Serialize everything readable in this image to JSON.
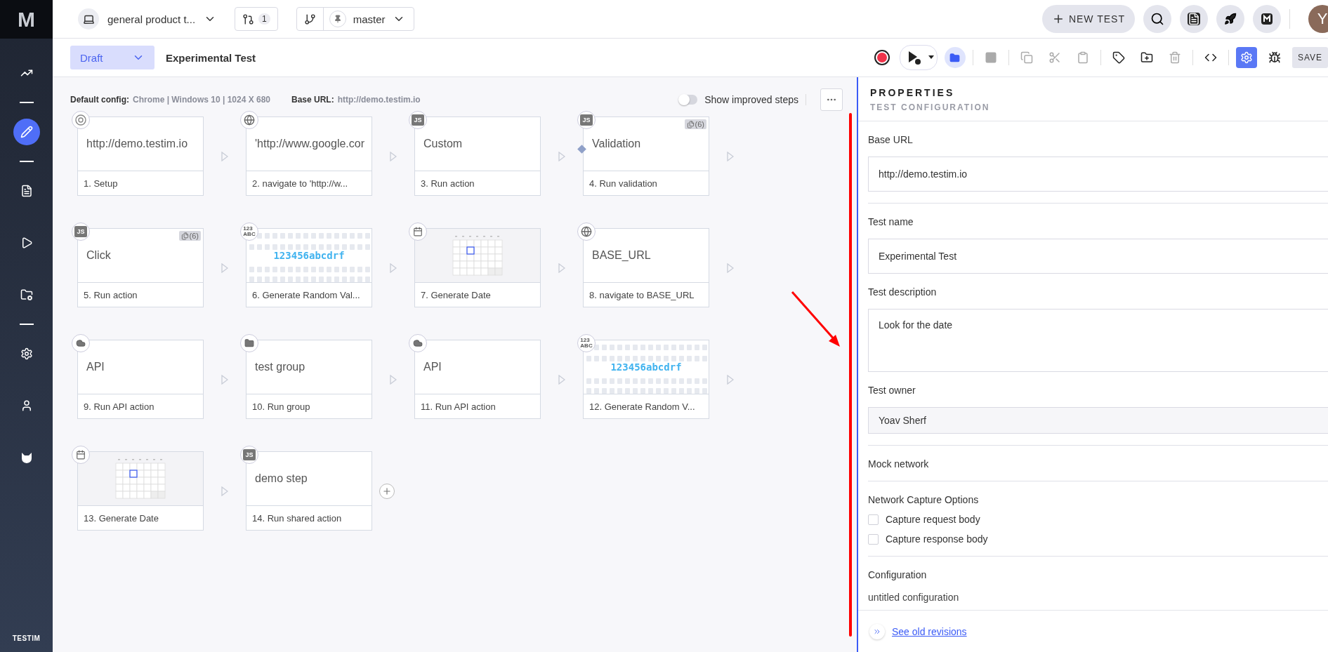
{
  "sidebar": {
    "logo": "M",
    "brand": "TESTIM",
    "items": [
      {
        "kind": "chart",
        "selected": false
      },
      {
        "kind": "divider"
      },
      {
        "kind": "pencil",
        "selected": true
      },
      {
        "kind": "divider"
      },
      {
        "kind": "list",
        "selected": false
      },
      {
        "kind": "play",
        "selected": false
      },
      {
        "kind": "folder-gear",
        "selected": false
      },
      {
        "kind": "divider"
      },
      {
        "kind": "gear",
        "selected": false
      },
      {
        "kind": "user",
        "selected": false
      },
      {
        "kind": "mask",
        "selected": false
      }
    ]
  },
  "topbar": {
    "project": "general product t...",
    "pull_requests": "1",
    "branch": "master",
    "new_test": "NEW TEST",
    "avatar": "Y"
  },
  "toolbar": {
    "status": "Draft",
    "title": "Experimental Test",
    "save": "SAVE",
    "tools": [
      {
        "kind": "record",
        "disabled": false,
        "active": false
      },
      {
        "kind": "run",
        "disabled": false,
        "active": false
      },
      {
        "kind": "folder",
        "disabled": false,
        "active": true
      },
      {
        "kind": "sep"
      },
      {
        "kind": "stop",
        "disabled": true,
        "active": false
      },
      {
        "kind": "sep"
      },
      {
        "kind": "copy",
        "disabled": true,
        "active": false
      },
      {
        "kind": "cut",
        "disabled": true,
        "active": false
      },
      {
        "kind": "paste",
        "disabled": true,
        "active": false
      },
      {
        "kind": "sep"
      },
      {
        "kind": "tag",
        "disabled": false,
        "active": false
      },
      {
        "kind": "folder-plus",
        "disabled": false,
        "active": false
      },
      {
        "kind": "trash",
        "disabled": true,
        "active": false
      },
      {
        "kind": "sep"
      },
      {
        "kind": "code",
        "disabled": false,
        "active": false
      },
      {
        "kind": "sep"
      },
      {
        "kind": "gear",
        "disabled": false,
        "active": true
      },
      {
        "kind": "bug",
        "disabled": false,
        "active": false
      }
    ]
  },
  "canvas": {
    "config_label": "Default config:",
    "config": "Chrome | Windows 10 | 1024 X 680",
    "base_label": "Base URL:",
    "base_url": "http://demo.testim.io",
    "toggle": {
      "label": "Show improved steps",
      "on": false
    },
    "steps": [
      {
        "kind": "chrome",
        "title": "http://demo.testim.io",
        "label": "1. Setup",
        "breakpoint": false
      },
      {
        "kind": "globe",
        "title": "'http://www.google.cor",
        "label": "2. navigate to 'http://w...",
        "breakpoint": false
      },
      {
        "kind": "js",
        "icon_label": "JS",
        "title": "Custom",
        "label": "3. Run action",
        "breakpoint": false
      },
      {
        "kind": "js",
        "icon_label": "JS",
        "title": "Validation",
        "label": "4. Run validation",
        "badge": "(6)",
        "breakpoint": true
      },
      {
        "kind": "js",
        "icon_label": "JS",
        "title": "Click",
        "label": "5. Run action",
        "badge": "(6)",
        "breakpoint": false
      },
      {
        "kind": "random",
        "icon_lines": [
          "123",
          "ABC"
        ],
        "title": "123456abcdrf",
        "label": "6. Generate Random Val...",
        "breakpoint": false
      },
      {
        "kind": "calendar",
        "label": "7. Generate Date",
        "breakpoint": false
      },
      {
        "kind": "globe",
        "title": "BASE_URL",
        "label": "8. navigate to BASE_URL",
        "breakpoint": false
      },
      {
        "kind": "cloud",
        "title": "API",
        "label": "9. Run API action",
        "breakpoint": false
      },
      {
        "kind": "folder",
        "title": "test group",
        "label": "10. Run group",
        "breakpoint": false
      },
      {
        "kind": "cloud",
        "title": "API",
        "label": "11. Run API action",
        "breakpoint": false
      },
      {
        "kind": "random",
        "icon_lines": [
          "123",
          "ABC"
        ],
        "title": "123456abcdrf",
        "label": "12. Generate Random V...",
        "breakpoint": false
      },
      {
        "kind": "calendar",
        "label": "13. Generate Date",
        "breakpoint": false
      },
      {
        "kind": "js",
        "icon_label": "JS",
        "title": "demo step",
        "label": "14. Run shared action",
        "breakpoint": false
      }
    ]
  },
  "properties": {
    "heading": "PROPERTIES",
    "subheading": "TEST CONFIGURATION",
    "sections": [
      {
        "kind": "input",
        "label": "Base URL",
        "value": "http://demo.testim.io"
      },
      {
        "kind": "input",
        "label": "Test name",
        "value": "Experimental Test"
      },
      {
        "kind": "textarea",
        "label": "Test description",
        "value": "Look for the date"
      },
      {
        "kind": "select",
        "label": "Test owner",
        "value": "Yoav Sherf"
      },
      {
        "kind": "plain",
        "label": "Mock network"
      },
      {
        "kind": "checks",
        "label": "Network Capture Options",
        "options": [
          {
            "label": "Capture request body",
            "checked": false
          },
          {
            "label": "Capture response body",
            "checked": false
          }
        ]
      },
      {
        "kind": "plain",
        "label": "Configuration",
        "value": "untitled configuration"
      }
    ],
    "footer_link": "See old revisions"
  }
}
